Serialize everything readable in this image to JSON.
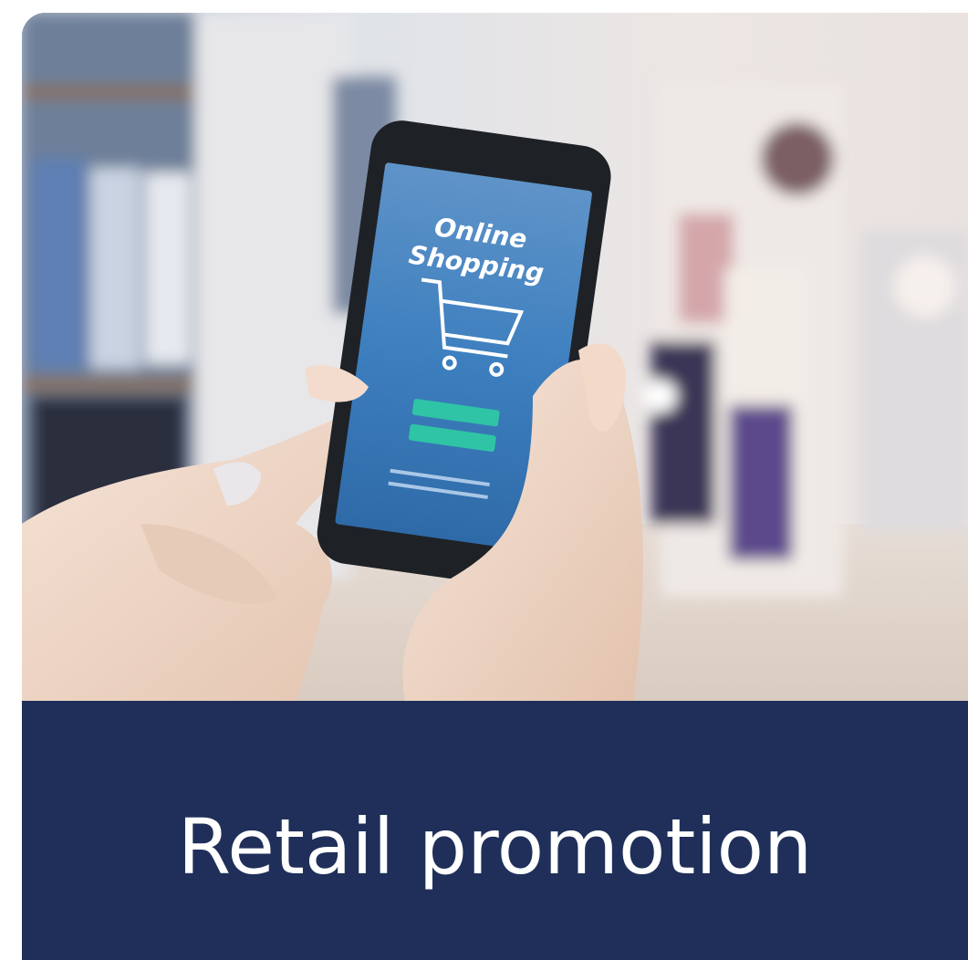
{
  "card": {
    "title": "Retail promotion",
    "accent_color": "#1f2f5a"
  },
  "photo": {
    "subject": "hands holding smartphone in clothing store",
    "phone_screen": {
      "line1": "Online",
      "line2": "Shopping",
      "icon": "shopping-cart-icon"
    }
  }
}
